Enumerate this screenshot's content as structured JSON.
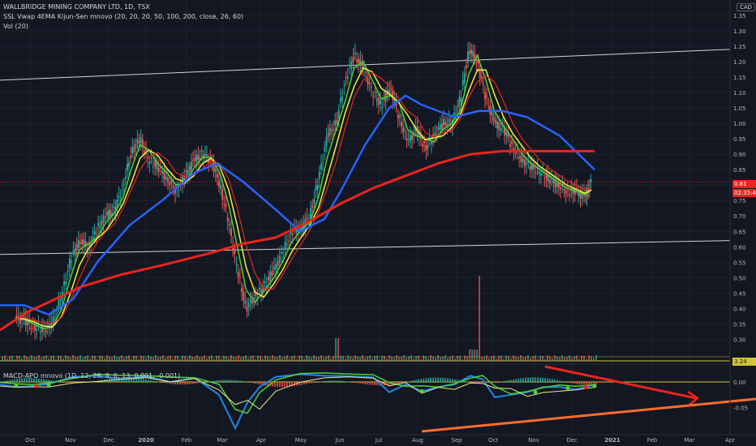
{
  "header": {
    "symbol_line": "WALLBRIDGE MINING COMPANY LTD, 1D, TSX",
    "indicator_line": "SSL Vwap 4EMA Kijun-Sen mnovo (20, 20, 20, 50, 100, 200, close, 26, 60)",
    "volume_line": "Vol (20)",
    "currency_badge": "CAD"
  },
  "macd_legend": "MACD-APO mnovo (1D, 12, 26, 9, 6, 13, 0.001, -0.001)",
  "tags": {
    "last_price": "0.81",
    "countdown": "02:35:48",
    "volume": "3.24"
  },
  "colors": {
    "background": "#131722",
    "grid": "#1e222d",
    "up_candle": "#26a69a",
    "down_candle": "#ef5350",
    "red_line": "#e8251f",
    "yellow_line": "#f2ef42",
    "green_line": "#4cd137",
    "blue_line": "#2962ff",
    "light_blue": "#1e88e5",
    "channel_line": "#d1d4dc",
    "orange": "#ff6d2e",
    "volume_line": "#d4c43a"
  },
  "chart_data": [
    {
      "type": "line",
      "title": "WALLBRIDGE MINING COMPANY LTD, 1D, TSX",
      "currency": "CAD",
      "ylim": [
        0.23,
        1.4
      ],
      "y_ticks": [
        "1.35",
        "1.30",
        "1.25",
        "1.20",
        "1.15",
        "1.10",
        "1.05",
        "1.00",
        "0.95",
        "0.90",
        "0.85",
        "0.80",
        "0.75",
        "0.70",
        "0.65",
        "0.60",
        "0.55",
        "0.50",
        "0.45",
        "0.40",
        "0.35",
        "0.30"
      ],
      "x_ticks": [
        "Oct",
        "Nov",
        "Dec",
        "2020",
        "Feb",
        "Mar",
        "Apr",
        "May",
        "Jun",
        "Jul",
        "Aug",
        "Sep",
        "Oct",
        "Nov",
        "Dec",
        "2021",
        "Feb",
        "Mar",
        "Apr"
      ],
      "x_dates": [
        "2019-10-01",
        "2019-11-01",
        "2019-12-01",
        "2020-01-01",
        "2020-02-01",
        "2020-03-01",
        "2020-04-01",
        "2020-05-01",
        "2020-06-01",
        "2020-07-01",
        "2020-08-01",
        "2020-09-01",
        "2020-10-01",
        "2020-11-01",
        "2020-12-01",
        "2021-01-01",
        "2021-02-01",
        "2021-03-01",
        "2021-04-01"
      ],
      "price_close_weekly": [
        [
          "2019-09-20",
          0.37
        ],
        [
          "2019-09-27",
          0.36
        ],
        [
          "2019-10-04",
          0.34
        ],
        [
          "2019-10-11",
          0.33
        ],
        [
          "2019-10-18",
          0.35
        ],
        [
          "2019-10-25",
          0.44
        ],
        [
          "2019-11-01",
          0.56
        ],
        [
          "2019-11-08",
          0.62
        ],
        [
          "2019-11-15",
          0.6
        ],
        [
          "2019-11-22",
          0.66
        ],
        [
          "2019-11-29",
          0.7
        ],
        [
          "2019-12-06",
          0.72
        ],
        [
          "2019-12-13",
          0.8
        ],
        [
          "2019-12-20",
          0.91
        ],
        [
          "2019-12-27",
          0.95
        ],
        [
          "2020-01-03",
          0.88
        ],
        [
          "2020-01-10",
          0.86
        ],
        [
          "2020-01-17",
          0.82
        ],
        [
          "2020-01-24",
          0.78
        ],
        [
          "2020-01-31",
          0.83
        ],
        [
          "2020-02-07",
          0.88
        ],
        [
          "2020-02-14",
          0.9
        ],
        [
          "2020-02-21",
          0.88
        ],
        [
          "2020-02-28",
          0.8
        ],
        [
          "2020-03-06",
          0.68
        ],
        [
          "2020-03-13",
          0.52
        ],
        [
          "2020-03-20",
          0.4
        ],
        [
          "2020-03-27",
          0.44
        ],
        [
          "2020-04-03",
          0.47
        ],
        [
          "2020-04-10",
          0.52
        ],
        [
          "2020-04-17",
          0.58
        ],
        [
          "2020-04-24",
          0.65
        ],
        [
          "2020-05-01",
          0.66
        ],
        [
          "2020-05-08",
          0.7
        ],
        [
          "2020-05-15",
          0.82
        ],
        [
          "2020-05-22",
          0.96
        ],
        [
          "2020-05-29",
          1.0
        ],
        [
          "2020-06-05",
          1.14
        ],
        [
          "2020-06-12",
          1.22
        ],
        [
          "2020-06-19",
          1.18
        ],
        [
          "2020-06-26",
          1.1
        ],
        [
          "2020-07-03",
          1.06
        ],
        [
          "2020-07-10",
          1.12
        ],
        [
          "2020-07-17",
          1.02
        ],
        [
          "2020-07-24",
          0.94
        ],
        [
          "2020-07-31",
          0.98
        ],
        [
          "2020-08-07",
          0.92
        ],
        [
          "2020-08-14",
          0.96
        ],
        [
          "2020-08-21",
          1.0
        ],
        [
          "2020-08-28",
          1.0
        ],
        [
          "2020-09-04",
          1.08
        ],
        [
          "2020-09-11",
          1.24
        ],
        [
          "2020-09-18",
          1.2
        ],
        [
          "2020-09-25",
          1.08
        ],
        [
          "2020-10-02",
          1.0
        ],
        [
          "2020-10-09",
          0.98
        ],
        [
          "2020-10-16",
          0.92
        ],
        [
          "2020-10-23",
          0.88
        ],
        [
          "2020-10-30",
          0.86
        ],
        [
          "2020-11-06",
          0.84
        ],
        [
          "2020-11-13",
          0.82
        ],
        [
          "2020-11-20",
          0.8
        ],
        [
          "2020-11-27",
          0.78
        ],
        [
          "2020-12-04",
          0.78
        ],
        [
          "2020-12-11",
          0.76
        ],
        [
          "2020-12-16",
          0.81
        ]
      ],
      "series": [
        {
          "name": "",
          "color": "red",
          "values": [
            [
              0,
              0.33
            ],
            [
              35,
              0.39
            ],
            [
              60,
              0.42
            ],
            [
              100,
              0.47
            ],
            [
              150,
              0.51
            ],
            [
              200,
              0.54
            ],
            [
              260,
              0.58
            ],
            [
              300,
              0.61
            ],
            [
              340,
              0.63
            ],
            [
              380,
              0.68
            ],
            [
              420,
              0.74
            ],
            [
              460,
              0.79
            ],
            [
              500,
              0.83
            ],
            [
              540,
              0.87
            ],
            [
              580,
              0.9
            ],
            [
              620,
              0.91
            ],
            [
              660,
              0.91
            ],
            [
              700,
              0.91
            ],
            [
              733,
              0.91
            ]
          ]
        },
        {
          "name": "",
          "color": "blue",
          "values": [
            [
              0,
              0.41
            ],
            [
              30,
              0.41
            ],
            [
              60,
              0.38
            ],
            [
              90,
              0.43
            ],
            [
              120,
              0.55
            ],
            [
              160,
              0.67
            ],
            [
              200,
              0.75
            ],
            [
              240,
              0.84
            ],
            [
              268,
              0.87
            ],
            [
              300,
              0.81
            ],
            [
              340,
              0.72
            ],
            [
              370,
              0.65
            ],
            [
              400,
              0.69
            ],
            [
              420,
              0.78
            ],
            [
              450,
              0.93
            ],
            [
              480,
              1.05
            ],
            [
              500,
              1.09
            ],
            [
              520,
              1.06
            ],
            [
              560,
              1.02
            ],
            [
              590,
              1.04
            ],
            [
              620,
              1.04
            ],
            [
              650,
              1.02
            ],
            [
              690,
              0.96
            ],
            [
              733,
              0.85
            ]
          ]
        }
      ]
    },
    {
      "type": "line",
      "title": "MACD-APO mnovo (1D, 12, 26, 9, 6, 13, 0.001, -0.001)",
      "ylim": [
        -0.09,
        0.03
      ],
      "y_ticks": [
        "0.00",
        "-0.05"
      ],
      "series": [
        {
          "name": "",
          "color": "blue",
          "values": [
            [
              0,
              -0.005
            ],
            [
              20,
              -0.01
            ],
            [
              40,
              -0.008
            ],
            [
              60,
              -0.004
            ],
            [
              90,
              0.01
            ],
            [
              120,
              0.012
            ],
            [
              150,
              0.006
            ],
            [
              180,
              0.011
            ],
            [
              210,
              0.0
            ],
            [
              240,
              0.008
            ],
            [
              270,
              -0.025
            ],
            [
              290,
              -0.09
            ],
            [
              305,
              -0.04
            ],
            [
              320,
              -0.01
            ],
            [
              340,
              0.01
            ],
            [
              370,
              0.015
            ],
            [
              400,
              0.012
            ],
            [
              430,
              0.011
            ],
            [
              460,
              0.009
            ],
            [
              480,
              -0.02
            ],
            [
              500,
              -0.005
            ],
            [
              520,
              -0.018
            ],
            [
              540,
              -0.01
            ],
            [
              560,
              -0.005
            ],
            [
              580,
              0.012
            ],
            [
              595,
              0.005
            ],
            [
              610,
              -0.03
            ],
            [
              630,
              -0.025
            ],
            [
              650,
              -0.02
            ],
            [
              670,
              -0.01
            ],
            [
              690,
              -0.01
            ],
            [
              710,
              -0.015
            ],
            [
              733,
              -0.005
            ]
          ]
        }
      ]
    },
    {
      "type": "bar",
      "title": "Vol (20)",
      "last_value": "3.24",
      "note": "volume histogram; largest spike in mid-September 2020"
    }
  ]
}
